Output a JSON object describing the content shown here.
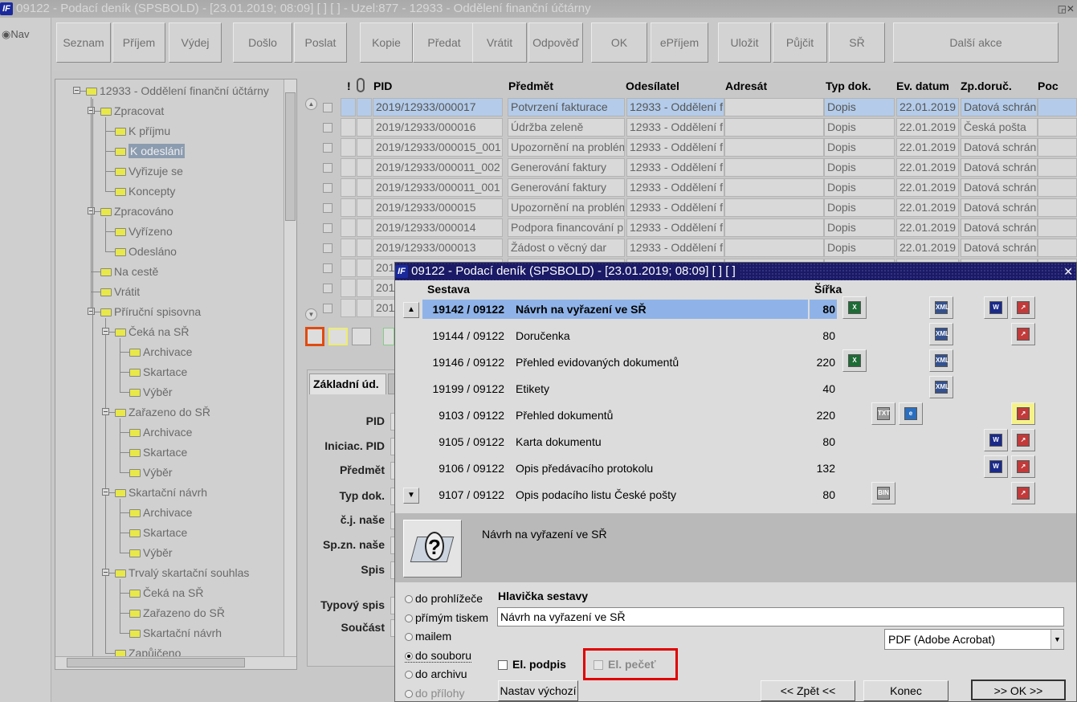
{
  "window": {
    "title": "09122 - Podací deník (SPSBOLD) - [23.01.2019; 08:09]  [ ]  [ ] - Uzel:877 - 12933 - Oddělení finanční účtárny",
    "icon_text": "IF",
    "controls": "◲✕"
  },
  "nav": {
    "label": "Nav"
  },
  "toolbar": {
    "buttons": [
      "Seznam",
      "Příjem",
      "Výdej",
      "Došlo",
      "Poslat",
      "Kopie",
      "Předat",
      "Vrátit",
      "Odpověď",
      "OK",
      "ePříjem",
      "Uložit",
      "Půjčit",
      "SŘ",
      "Další akce"
    ]
  },
  "tree": {
    "items": [
      {
        "label": "12933 - Oddělení finanční účtárny"
      },
      {
        "label": "Zpracovat"
      },
      {
        "label": "K příjmu"
      },
      {
        "label": "K odeslání",
        "selected": true
      },
      {
        "label": "Vyřizuje se"
      },
      {
        "label": "Koncepty"
      },
      {
        "label": "Zpracováno"
      },
      {
        "label": "Vyřízeno"
      },
      {
        "label": "Odesláno"
      },
      {
        "label": "Na cestě"
      },
      {
        "label": "Vrátit"
      },
      {
        "label": "Příruční spisovna"
      },
      {
        "label": "Čeká na SŘ"
      },
      {
        "label": "Archivace"
      },
      {
        "label": "Skartace"
      },
      {
        "label": "Výběr"
      },
      {
        "label": "Zařazeno do SŘ"
      },
      {
        "label": "Archivace"
      },
      {
        "label": "Skartace"
      },
      {
        "label": "Výběr"
      },
      {
        "label": "Skartační návrh"
      },
      {
        "label": "Archivace"
      },
      {
        "label": "Skartace"
      },
      {
        "label": "Výběr"
      },
      {
        "label": "Trvalý skartační souhlas"
      },
      {
        "label": "Čeká na SŘ"
      },
      {
        "label": "Zařazeno do SŘ"
      },
      {
        "label": "Skartační návrh"
      },
      {
        "label": "Zapůjčeno"
      }
    ]
  },
  "grid": {
    "headers": [
      "!",
      "PID",
      "Předmět",
      "Odesílatel",
      "Adresát",
      "Typ dok.",
      "Ev. datum",
      "Zp.doruč.",
      "Poc"
    ],
    "rows": [
      {
        "pid": "2019/12933/000017",
        "predmet": "Potvrzení fakturace",
        "odesilatel": "12933 - Oddělení f",
        "typ": "Dopis",
        "datum": "22.01.2019",
        "zp": "Datová schrán"
      },
      {
        "pid": "2019/12933/000016",
        "predmet": "Údržba zeleně",
        "odesilatel": "12933 - Oddělení f",
        "typ": "Dopis",
        "datum": "22.01.2019",
        "zp": "Česká pošta"
      },
      {
        "pid": "2019/12933/000015_001",
        "predmet": "Upozornění na problém",
        "odesilatel": "12933 - Oddělení f",
        "typ": "Dopis",
        "datum": "22.01.2019",
        "zp": "Datová schrán"
      },
      {
        "pid": "2019/12933/000011_002",
        "predmet": "Generování faktury",
        "odesilatel": "12933 - Oddělení f",
        "typ": "Dopis",
        "datum": "22.01.2019",
        "zp": "Datová schrán"
      },
      {
        "pid": "2019/12933/000011_001",
        "predmet": "Generování faktury",
        "odesilatel": "12933 - Oddělení f",
        "typ": "Dopis",
        "datum": "22.01.2019",
        "zp": "Datová schrán"
      },
      {
        "pid": "2019/12933/000015",
        "predmet": "Upozornění na problém",
        "odesilatel": "12933 - Oddělení f",
        "typ": "Dopis",
        "datum": "22.01.2019",
        "zp": "Datová schrán"
      },
      {
        "pid": "2019/12933/000014",
        "predmet": "Podpora financování p",
        "odesilatel": "12933 - Oddělení f",
        "typ": "Dopis",
        "datum": "22.01.2019",
        "zp": "Datová schrán"
      },
      {
        "pid": "2019/12933/000013",
        "predmet": "Žádost o věcný dar",
        "odesilatel": "12933 - Oddělení f",
        "typ": "Dopis",
        "datum": "22.01.2019",
        "zp": "Datová schrán"
      },
      {
        "pid": "201",
        "predmet": "",
        "odesilatel": "",
        "typ": "",
        "datum": "",
        "zp": ""
      },
      {
        "pid": "201",
        "predmet": "",
        "odesilatel": "",
        "typ": "",
        "datum": "",
        "zp": ""
      },
      {
        "pid": "201",
        "predmet": "",
        "odesilatel": "",
        "typ": "",
        "datum": "",
        "zp": ""
      }
    ]
  },
  "lower": {
    "tab": "Základní úd.",
    "labels": [
      "PID",
      "Iniciac. PID",
      "Předmět",
      "Typ dok.",
      "č.j. naše",
      "Sp.zn. naše",
      "Spis",
      "Typový spis",
      "Součást"
    ]
  },
  "dialog": {
    "title": "09122 - Podací deník (SPSBOLD) - [23.01.2019; 08:09]  [ ]  [ ]",
    "col_sestava": "Sestava",
    "col_sirka": "Šířka",
    "reports": [
      {
        "code": "19142 / 09122",
        "name": "Návrh na vyřazení ve SŘ",
        "width": "80",
        "icons": [
          "xls",
          "xml",
          "doc",
          "pdf"
        ]
      },
      {
        "code": "19144 / 09122",
        "name": "Doručenka",
        "width": "80",
        "icons": [
          "xml",
          "pdf"
        ]
      },
      {
        "code": "19146 / 09122",
        "name": "Přehled evidovaných dokumentů",
        "width": "220",
        "icons": [
          "xls",
          "xml"
        ]
      },
      {
        "code": "19199 / 09122",
        "name": "Etikety",
        "width": "40",
        "icons": [
          "xml"
        ]
      },
      {
        "code": "9103 / 09122",
        "name": "Přehled dokumentů",
        "width": "220",
        "icons": [
          "txt",
          "ie",
          "pdf"
        ]
      },
      {
        "code": "9105 / 09122",
        "name": "Karta dokumentu",
        "width": "80",
        "icons": [
          "doc",
          "pdf"
        ]
      },
      {
        "code": "9106 / 09122",
        "name": "Opis předávacího protokolu",
        "width": "132",
        "icons": [
          "doc",
          "pdf"
        ]
      },
      {
        "code": "9107 / 09122",
        "name": "Opis podacího listu České pošty",
        "width": "80",
        "icons": [
          "bin",
          "pdf"
        ]
      }
    ],
    "icon_text": {
      "xls": "X",
      "xml": "XML",
      "doc": "W",
      "pdf": "↗",
      "txt": "TXT",
      "ie": "e",
      "bin": "BIN"
    },
    "info_text": "Návrh na vyřazení ve SŘ",
    "outputs": [
      {
        "label": "do prohlížeče",
        "on": false,
        "disabled": false
      },
      {
        "label": "přímým tiskem",
        "on": false,
        "disabled": false
      },
      {
        "label": "mailem",
        "on": false,
        "disabled": false
      },
      {
        "label": "do souboru",
        "on": true,
        "disabled": false
      },
      {
        "label": "do archivu",
        "on": false,
        "disabled": false
      },
      {
        "label": "do přílohy",
        "on": false,
        "disabled": true
      }
    ],
    "header_label": "Hlavička sestavy",
    "header_value": "Návrh na vyřazení ve SŘ",
    "format": "PDF (Adobe Acrobat)",
    "el_podpis": "El. podpis",
    "el_pecet": "El. pečeť",
    "btn_default": "Nastav výchozí",
    "btn_back": "<< Zpět <<",
    "btn_end": "Konec",
    "btn_ok": ">> OK >>"
  },
  "colors": {
    "highlight": "#b4ccea",
    "dialog_title": "#1a1a66",
    "red_frame": "#e00000",
    "selected_row": "#8fb3e8"
  }
}
